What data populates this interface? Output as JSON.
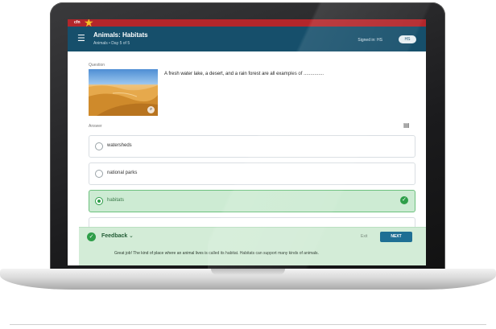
{
  "topbar": {
    "chip": "cfn"
  },
  "header": {
    "title": "Animals: Habitats",
    "subtitle": "Animals • Day 5 of 5",
    "right_text": "Signed in: HS",
    "pill": "HS"
  },
  "question": {
    "label": "Question",
    "text": "A fresh water lake, a desert, and a rain forest are all examples of ..............."
  },
  "answers": {
    "label": "Answer",
    "options": [
      {
        "label": "watersheds"
      },
      {
        "label": "national parks"
      },
      {
        "label": "habitats",
        "selected": true
      }
    ]
  },
  "feedback": {
    "title": "Feedback",
    "exit_label": "Exit",
    "next_label": "NEXT",
    "text": "Great job! The kind of place where an animal lives is called its habitat. Habitats can support many kinds of animals."
  },
  "colors": {
    "header": "#164f6b",
    "accent_red": "#b3262b",
    "correct_green": "#2e9e49",
    "feedback_bg": "#d3ecd7",
    "next_button": "#1f6f94"
  },
  "icons": [
    "star-icon",
    "menu-icon",
    "zoom-icon",
    "list-icon",
    "radio-icon",
    "check-icon",
    "chevron-down-icon"
  ]
}
